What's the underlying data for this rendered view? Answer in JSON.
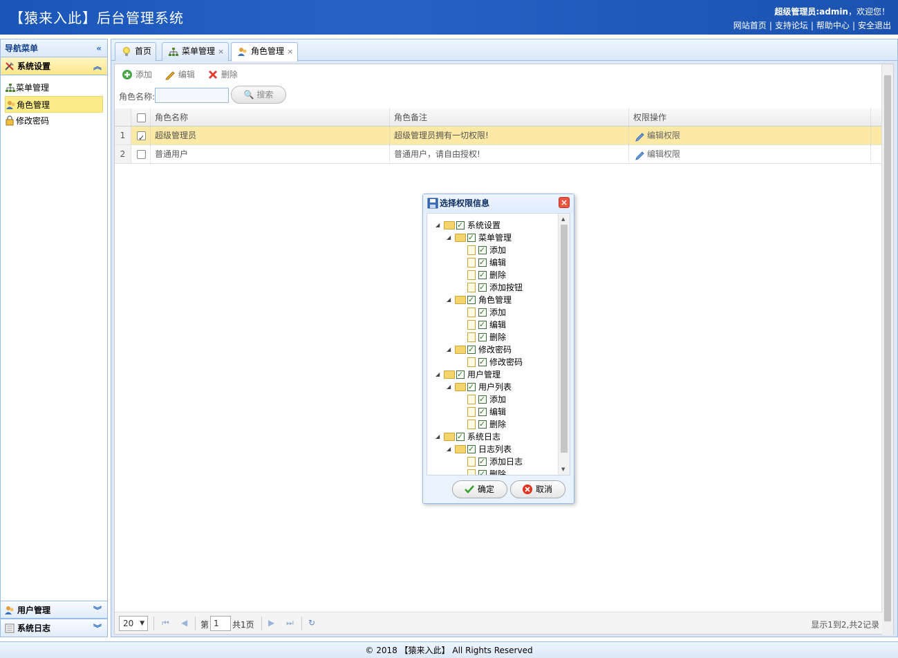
{
  "header": {
    "title": "【猿来入此】后台管理系统",
    "welcome_user": "超级管理员:admin",
    "welcome_suffix": "，欢迎您！",
    "links": [
      "网站首页",
      "支持论坛",
      "帮助中心",
      "安全退出"
    ],
    "link_sep": "|"
  },
  "nav": {
    "title": "导航菜单",
    "collapse_icon": "double-chevron-left-icon",
    "sections": [
      {
        "label": "系统设置",
        "icon": "tools-icon",
        "expanded": true
      },
      {
        "label": "用户管理",
        "icon": "users-icon",
        "expanded": false
      },
      {
        "label": "系统日志",
        "icon": "log-icon",
        "expanded": false
      }
    ],
    "items": [
      {
        "label": "菜单管理",
        "icon": "sitemap-icon",
        "selected": false
      },
      {
        "label": "角色管理",
        "icon": "role-icon",
        "selected": true
      },
      {
        "label": "修改密码",
        "icon": "key-icon",
        "selected": false
      }
    ]
  },
  "tabs": [
    {
      "label": "首页",
      "icon": "bulb-icon",
      "closable": false,
      "active": false
    },
    {
      "label": "菜单管理",
      "icon": "sitemap-icon",
      "closable": true,
      "active": false
    },
    {
      "label": "角色管理",
      "icon": "role-icon",
      "closable": true,
      "active": true
    }
  ],
  "tab_close": "×",
  "toolbar": {
    "add": "添加",
    "edit": "编辑",
    "delete": "删除"
  },
  "search": {
    "label": "角色名称:",
    "value": "",
    "button": "搜索"
  },
  "grid": {
    "columns": [
      "角色名称",
      "角色备注",
      "权限操作"
    ],
    "rows": [
      {
        "num": "1",
        "checked": true,
        "name": "超级管理员",
        "note": "超级管理员拥有一切权限!",
        "op": "编辑权限",
        "selected": true
      },
      {
        "num": "2",
        "checked": false,
        "name": "普通用户",
        "note": "普通用户，请自由授权!",
        "op": "编辑权限",
        "selected": false
      }
    ]
  },
  "pager": {
    "page_size": "20",
    "page_label": "第",
    "page_value": "1",
    "page_total": "共1页",
    "info": "显示1到2,共2记录"
  },
  "dialog": {
    "title": "选择权限信息",
    "close": "×",
    "ok": "确定",
    "cancel": "取消",
    "tree": [
      {
        "label": "系统设置",
        "level": 0,
        "folder": true
      },
      {
        "label": "菜单管理",
        "level": 1,
        "folder": true
      },
      {
        "label": "添加",
        "level": 2,
        "folder": false
      },
      {
        "label": "编辑",
        "level": 2,
        "folder": false
      },
      {
        "label": "删除",
        "level": 2,
        "folder": false
      },
      {
        "label": "添加按钮",
        "level": 2,
        "folder": false
      },
      {
        "label": "角色管理",
        "level": 1,
        "folder": true
      },
      {
        "label": "添加",
        "level": 2,
        "folder": false
      },
      {
        "label": "编辑",
        "level": 2,
        "folder": false
      },
      {
        "label": "删除",
        "level": 2,
        "folder": false
      },
      {
        "label": "修改密码",
        "level": 1,
        "folder": true
      },
      {
        "label": "修改密码",
        "level": 2,
        "folder": false
      },
      {
        "label": "用户管理",
        "level": 0,
        "folder": true
      },
      {
        "label": "用户列表",
        "level": 1,
        "folder": true
      },
      {
        "label": "添加",
        "level": 2,
        "folder": false
      },
      {
        "label": "编辑",
        "level": 2,
        "folder": false
      },
      {
        "label": "删除",
        "level": 2,
        "folder": false
      },
      {
        "label": "系统日志",
        "level": 0,
        "folder": true
      },
      {
        "label": "日志列表",
        "level": 1,
        "folder": true
      },
      {
        "label": "添加日志",
        "level": 2,
        "folder": false
      },
      {
        "label": "删除",
        "level": 2,
        "folder": false
      }
    ]
  },
  "footer": {
    "text": "© 2018 【猿来入此】 All Rights Reserved"
  }
}
